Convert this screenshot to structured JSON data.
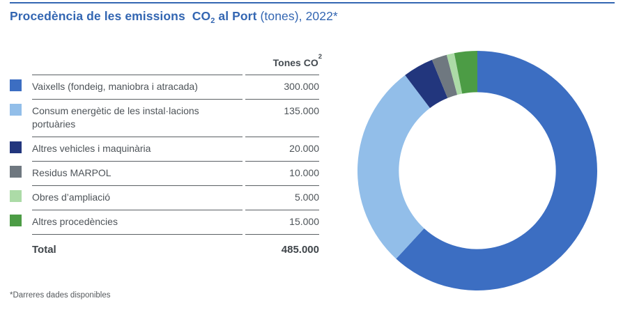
{
  "title": {
    "bold_pre": "Procedència de les emissions  CO",
    "subscript": "2",
    "bold_post": " al Port",
    "tail": " (tones), 2022*"
  },
  "table": {
    "value_header": "Tones CO",
    "value_header_subscript": "2",
    "rows": [
      {
        "label": "Vaixells (fondeig, maniobra i atracada)",
        "value": "300.000",
        "color": "#3c6ec2"
      },
      {
        "label": "Consum energètic de les instal·lacions portuàries",
        "value": "135.000",
        "color": "#92bee9"
      },
      {
        "label": "Altres vehicles i maquinària",
        "value": "20.000",
        "color": "#22367d"
      },
      {
        "label": "Residus MARPOL",
        "value": "10.000",
        "color": "#6f7880"
      },
      {
        "label": "Obres d’ampliació",
        "value": "5.000",
        "color": "#acdba7"
      },
      {
        "label": "Altres procedències",
        "value": "15.000",
        "color": "#4c9c45"
      }
    ],
    "total_label": "Total",
    "total_value": "485.000"
  },
  "footnote": "*Darreres dades disponibles",
  "colors": {
    "accent_blue": "#3366b2",
    "text": "#4d5358",
    "rule": "#5a5f63"
  },
  "chart_data": {
    "type": "pie",
    "subtype": "donut",
    "title": "Procedència de les emissions CO2 al Port (tones), 2022",
    "categories": [
      "Vaixells (fondeig, maniobra i atracada)",
      "Consum energètic de les instal·lacions portuàries",
      "Altres vehicles i maquinària",
      "Residus MARPOL",
      "Obres d’ampliació",
      "Altres procedències"
    ],
    "values": [
      300000,
      135000,
      20000,
      10000,
      5000,
      15000
    ],
    "colors": [
      "#3c6ec2",
      "#92bee9",
      "#22367d",
      "#6f7880",
      "#acdba7",
      "#4c9c45"
    ],
    "total": 485000,
    "unit": "tones CO2",
    "start_angle_deg": 0,
    "direction": "clockwise",
    "inner_radius_ratio": 0.655,
    "legend_position": "left-table"
  }
}
